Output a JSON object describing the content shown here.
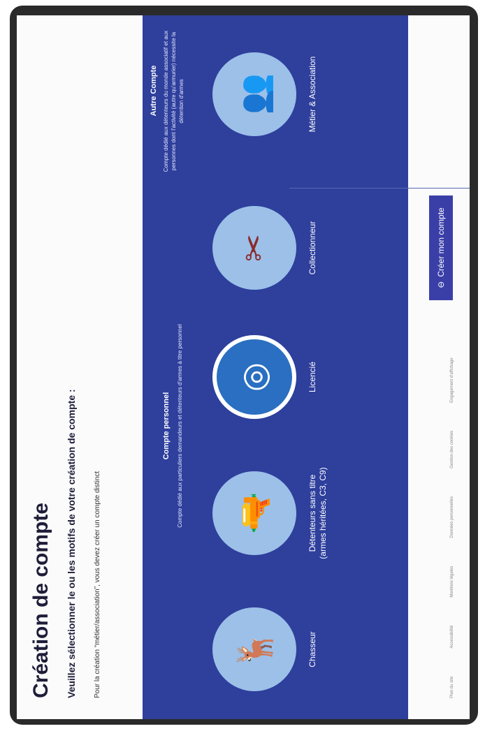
{
  "page": {
    "title": "Création de compte",
    "subtitle": "Veuillez sélectionner le ou les motifs de votre création de compte :",
    "note": "Pour la création “métier/association”, vous devez créer un compte distinct"
  },
  "groups": [
    {
      "heading": "Compte personnel",
      "description": "Compte dédié aux particuliers demandeurs et détenteurs d'armes à titre personnel"
    },
    {
      "heading": "Autre Compte",
      "description": "Compte dédié aux détenteurs du monde associatif et aux personnes dont l'activité (autre qu'armurier) nécessite la détention d'armes"
    }
  ],
  "tiles": [
    {
      "label": "Chasseur",
      "icon": "deer-icon",
      "glyph": "🦌"
    },
    {
      "label": "Détenteurs sans titre (armes héritées, C3, C9)",
      "icon": "gun-icon",
      "glyph": "🔫"
    },
    {
      "label": "Licencié",
      "icon": "target-icon",
      "glyph": "◎"
    },
    {
      "label": "Collectionneur",
      "icon": "rifles-icon",
      "glyph": "✂"
    },
    {
      "label": "Métier & Association",
      "icon": "people-icon",
      "glyph": "👥"
    }
  ],
  "cta": {
    "label": "Créer mon compte",
    "icon": "user-icon"
  },
  "footer": {
    "items": [
      "Plan du site",
      "Accessibilité",
      "Mentions légales",
      "Données personnelles",
      "Gestion des cookies",
      "Engagement d'affichage"
    ]
  },
  "colors": {
    "band": "#2e3f9c",
    "circle": "#9cc0e8",
    "cta": "#3a3fa8"
  }
}
